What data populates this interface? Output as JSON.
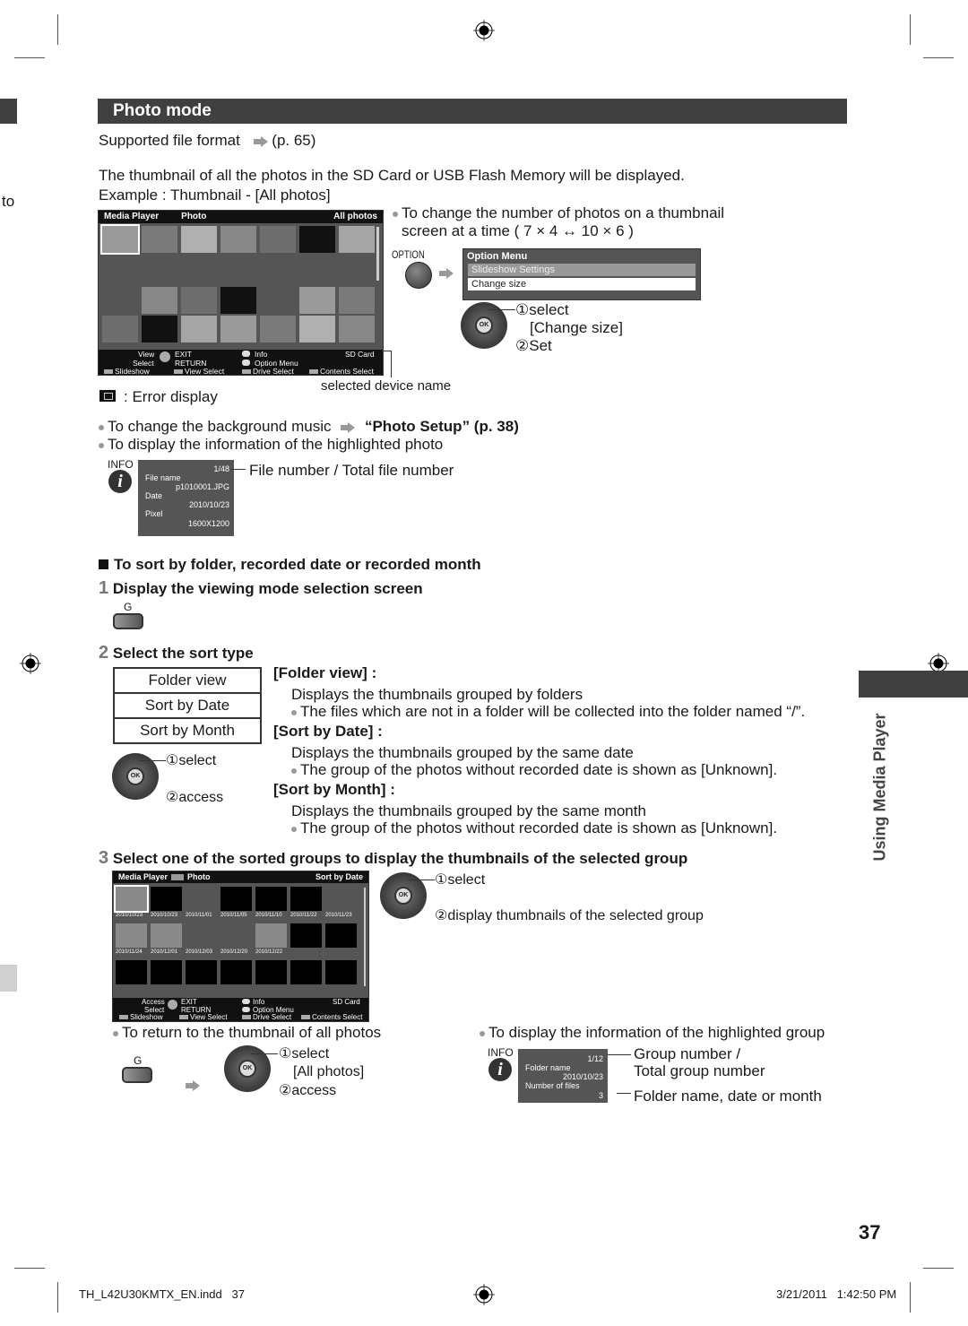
{
  "left_margin_text": "to",
  "section": {
    "title": "Photo mode"
  },
  "supported_format": {
    "label": "Supported file format",
    "ref": "(p. 65)"
  },
  "intro": {
    "line1": "The thumbnail of all the photos in the SD Card or USB Flash Memory will be displayed.",
    "line2": "Example : Thumbnail - [All photos]"
  },
  "screen1": {
    "header_left": "Media Player",
    "header_mid": "Photo",
    "header_right": "All photos",
    "footer": {
      "view": "View",
      "select": "Select",
      "exit": "EXIT",
      "return": "RETURN",
      "info": "Info",
      "option_menu": "Option Menu",
      "device": "SD Card",
      "slideshow": "Slideshow",
      "view_select": "View Select",
      "drive_select": "Drive Select",
      "contents_select": "Contents Select"
    }
  },
  "callout_device": "selected device name",
  "error_display": ": Error display",
  "change_number": {
    "line1": "To change the number of photos on a thumbnail",
    "line2": "screen at a time ( 7 × 4 ↔ 10 × 6 )"
  },
  "option_button_label": "OPTION",
  "option_menu": {
    "title": "Option Menu",
    "items": [
      "Slideshow Settings",
      "Change size"
    ],
    "selected_index": 1
  },
  "option_steps": {
    "step1": "①select",
    "step1b": "[Change size]",
    "step2": "②Set"
  },
  "ok_label": "OK",
  "bg_music": {
    "text": "To change the background music",
    "link": "“Photo Setup” (p. 38)"
  },
  "display_info": "To display the information of the highlighted photo",
  "info_label": "INFO",
  "photo_info": {
    "counter": "1/48",
    "file_name_label": "File name",
    "file_name": "p1010001.JPG",
    "date_label": "Date",
    "date": "2010/10/23",
    "pixel_label": "Pixel",
    "pixel": "1600X1200",
    "callout": "File number / Total file number"
  },
  "sort_heading": "To sort by folder, recorded date or recorded month",
  "step1": {
    "num": "1",
    "text": "Display the viewing mode selection screen"
  },
  "g_label": "G",
  "step2": {
    "num": "2",
    "text": "Select the sort type"
  },
  "sort_options": [
    "Folder view",
    "Sort by Date",
    "Sort by Month"
  ],
  "sort_steps": {
    "select": "①select",
    "access": "②access"
  },
  "descriptions": [
    {
      "title": "[Folder view] :",
      "text": "Displays the thumbnails grouped by folders",
      "note": "The files which are not in a folder will be collected into the folder named “/”."
    },
    {
      "title": "[Sort by Date] :",
      "text": "Displays the thumbnails grouped by the same date",
      "note": "The group of the photos without recorded date is shown as [Unknown]."
    },
    {
      "title": "[Sort by Month] :",
      "text": "Displays the thumbnails grouped by the same month",
      "note": "The group of the photos without recorded date is shown as [Unknown]."
    }
  ],
  "step3": {
    "num": "3",
    "text": "Select one of the sorted groups to display the thumbnails of the selected group"
  },
  "screen2": {
    "header_left": "Media Player",
    "header_mid": "Photo",
    "header_right": "Sort by Date",
    "dates_row1": [
      "2010/10/23",
      "2010/10/23",
      "2010/11/01",
      "2010/11/05",
      "2010/11/10",
      "2010/11/22",
      "2010/11/23"
    ],
    "dates_row2": [
      "2010/11/24",
      "2010/12/01",
      "2010/12/03",
      "2010/12/20",
      "2010/12/22"
    ],
    "footer": {
      "access": "Access",
      "select": "Select",
      "exit": "EXIT",
      "return": "RETURN",
      "info": "Info",
      "option_menu": "Option Menu",
      "device": "SD Card",
      "slideshow": "Slideshow",
      "view_select": "View Select",
      "drive_select": "Drive Select",
      "contents_select": "Contents Select"
    }
  },
  "step3_callouts": {
    "select": "①select",
    "display": "②display thumbnails of the selected group"
  },
  "return_all": {
    "text": "To return to the thumbnail of all photos",
    "select": "①select",
    "select_b": "[All photos]",
    "access": "②access"
  },
  "group_info": {
    "heading": "To display the information of the highlighted group",
    "counter": "1/12",
    "folder_label": "Folder name",
    "folder": "2010/10/23",
    "files_label": "Number of files",
    "files": "3",
    "callout1a": "Group number /",
    "callout1b": "Total group number",
    "callout2": "Folder name, date or month"
  },
  "side_tab": "Using Media Player",
  "page_number": "37",
  "footer": {
    "file": "TH_L42U30KMTX_EN.indd   37",
    "timestamp": "3/21/2011   1:42:50 PM"
  }
}
